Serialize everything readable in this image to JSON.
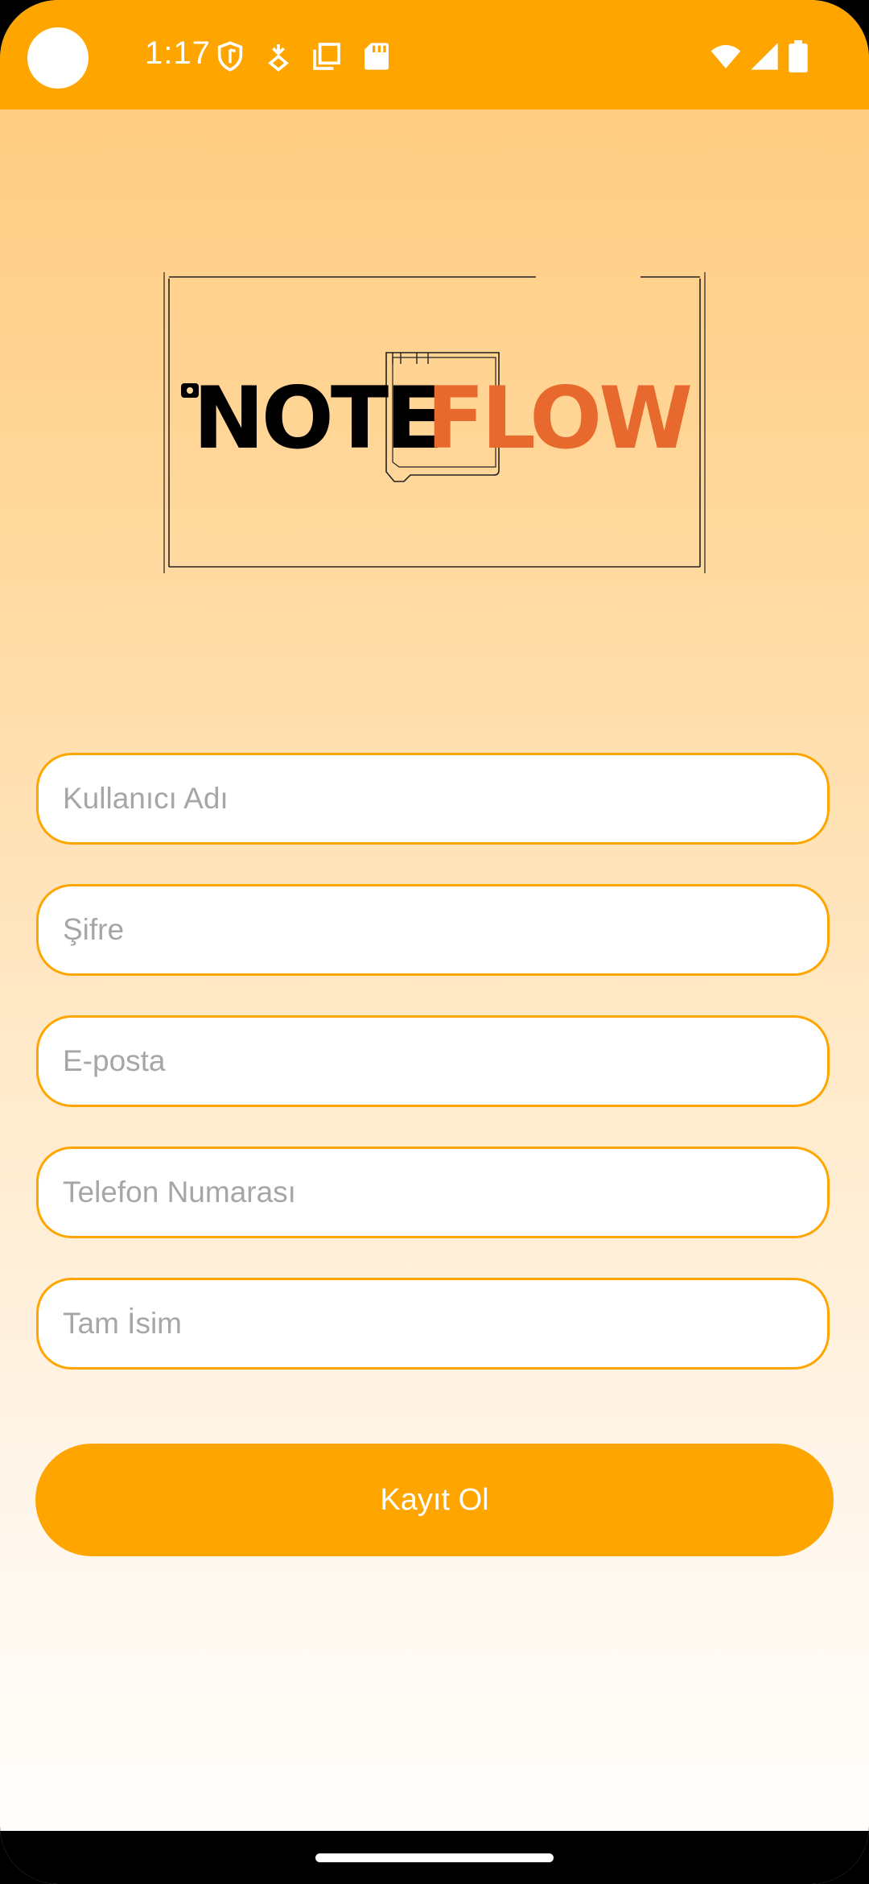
{
  "status_bar": {
    "time": "1:17",
    "background_color": "#FFA500",
    "icons": [
      "shield-icon",
      "download-icon",
      "copy-icon",
      "sd-card-icon",
      "wifi-icon",
      "signal-icon",
      "battery-icon"
    ]
  },
  "logo": {
    "text_dark": "NOTE",
    "text_accent": "FLOW",
    "accent_color": "#E8692E"
  },
  "form": {
    "username_placeholder": "Kullanıcı Adı",
    "password_placeholder": "Şifre",
    "email_placeholder": "E-posta",
    "phone_placeholder": "Telefon Numarası",
    "fullname_placeholder": "Tam İsim",
    "username_value": "",
    "password_value": "",
    "email_value": "",
    "phone_value": "",
    "fullname_value": ""
  },
  "register_button": {
    "label": "Kayıt Ol",
    "color": "#FFA500"
  },
  "theme": {
    "accent": "#FFA500"
  }
}
